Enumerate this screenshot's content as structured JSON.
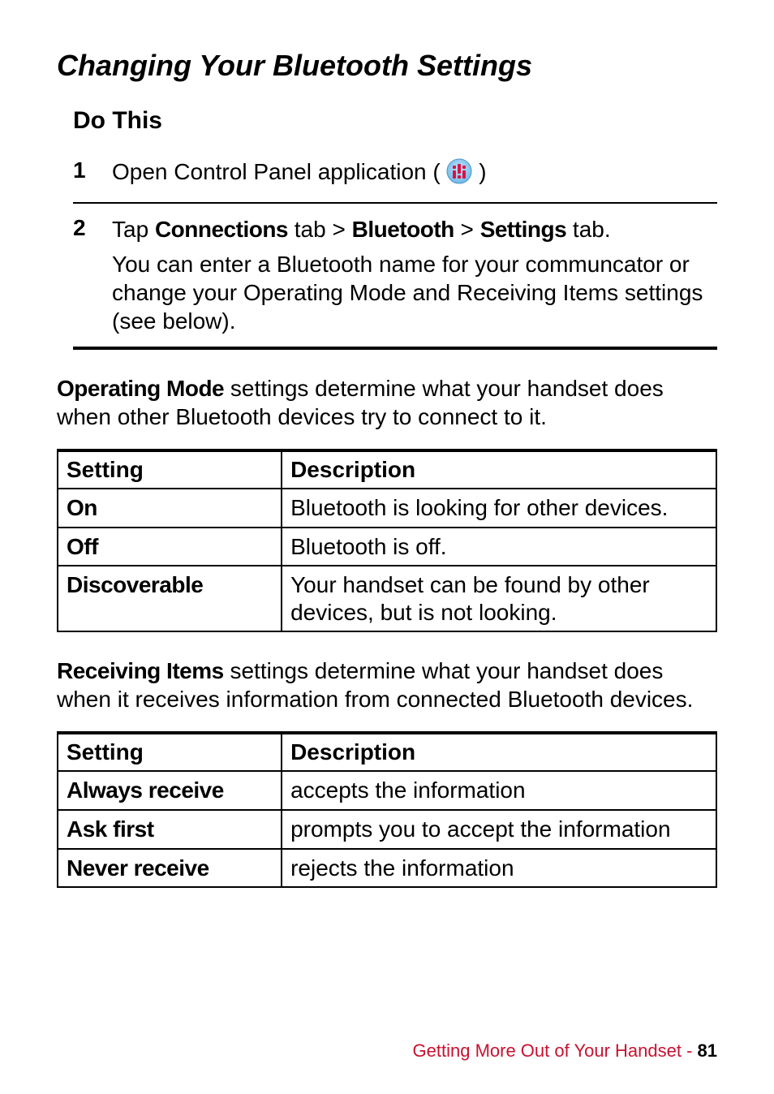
{
  "heading": "Changing Your Bluetooth Settings",
  "do_this": "Do This",
  "steps": {
    "s1": {
      "num": "1",
      "text_pre": "Open Control Panel application (",
      "text_post": ")"
    },
    "s2": {
      "num": "2",
      "l1_a": "Tap ",
      "l1_b": "Connections",
      "l1_c": " tab > ",
      "l1_d": "Bluetooth",
      "l1_e": " > ",
      "l1_f": "Settings",
      "l1_g": " tab.",
      "l2": "You can enter a Bluetooth name for your communcator or change your Operating Mode and Receiving Items settings (see below)."
    }
  },
  "op_mode": {
    "label": "Operating Mode",
    "rest": " settings determine what your handset does when other Bluetooth devices try to connect to it."
  },
  "tables": {
    "t1": {
      "h1": "Setting",
      "h2": "Description",
      "rows": [
        {
          "s": "On",
          "d": "Bluetooth is looking for other devices."
        },
        {
          "s": "Off",
          "d": "Bluetooth is off."
        },
        {
          "s": "Discoverable",
          "d": "Your handset can be found by other devices, but is not looking."
        }
      ]
    },
    "t2": {
      "h1": "Setting",
      "h2": "Description",
      "rows": [
        {
          "s": "Always receive",
          "d": "accepts the information"
        },
        {
          "s": "Ask first",
          "d": "prompts you to accept the information"
        },
        {
          "s": "Never receive",
          "d": "rejects the information"
        }
      ]
    }
  },
  "recv_items": {
    "label": "Receiving Items",
    "rest": " settings determine what your handset does when it receives information from connected Bluetooth devices."
  },
  "footer": {
    "section": "Getting More Out of Your Handset",
    "sep": " - ",
    "page": "81"
  }
}
